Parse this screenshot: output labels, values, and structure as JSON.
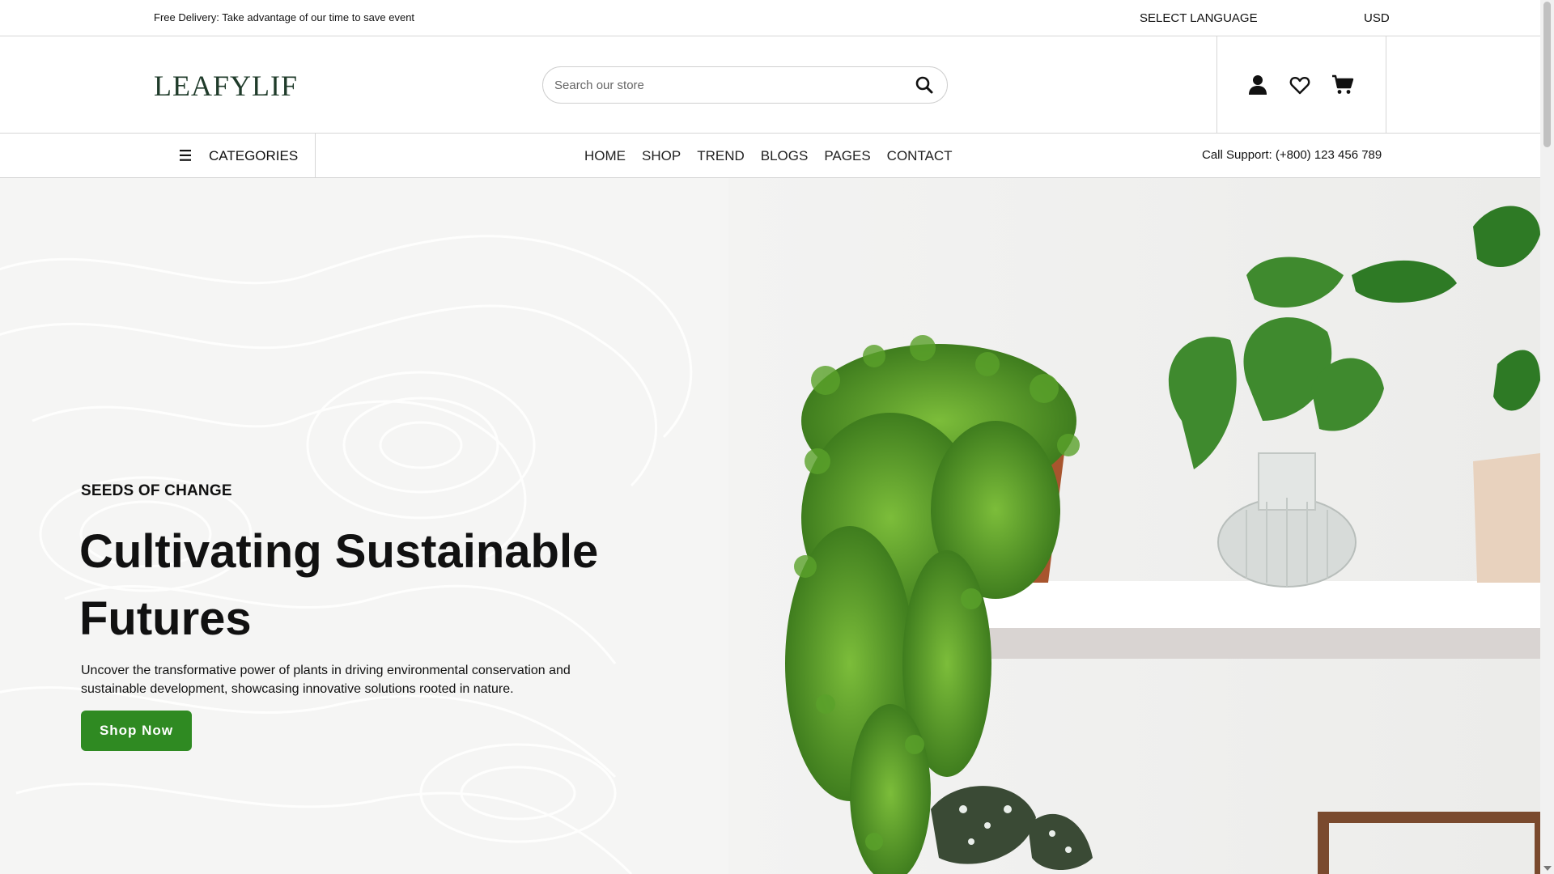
{
  "topbar": {
    "promo": "Free Delivery: Take advantage of our time to save event",
    "language": "SELECT LANGUAGE",
    "currency": "USD"
  },
  "header": {
    "logo": "LEAFYLIF",
    "search_placeholder": "Search our store",
    "icons": [
      "user-icon",
      "heart-icon",
      "cart-icon",
      "search-icon"
    ]
  },
  "nav": {
    "categories_label": "CATEGORIES",
    "links": [
      "HOME",
      "SHOP",
      "TREND",
      "BLOGS",
      "PAGES",
      "CONTACT"
    ],
    "support": "Call Support: (+800) 123 456 789"
  },
  "hero": {
    "kicker": "SEEDS OF CHANGE",
    "headline": "Cultivating Sustainable Futures",
    "description": "Uncover the transformative power of plants in driving environmental conservation and sustainable development, showcasing innovative solutions rooted in nature.",
    "cta": "Shop Now"
  },
  "colors": {
    "accent_green": "#2f8a22",
    "logo_green": "#1f3b2a",
    "border": "#d6d6d6"
  }
}
